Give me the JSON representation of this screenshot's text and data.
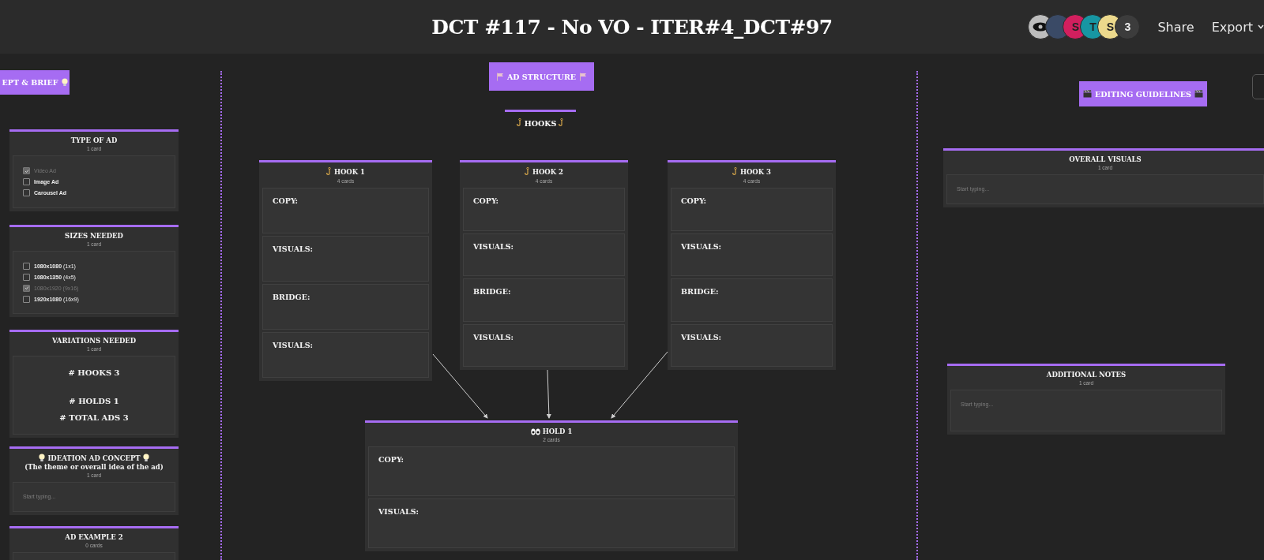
{
  "header": {
    "title": "DCT #117 - No VO - ITER#4_DCT#97",
    "avatars": [
      {
        "kind": "eye"
      },
      {
        "kind": "photo"
      },
      {
        "kind": "letter",
        "initial": "S",
        "color": "#d21f5e"
      },
      {
        "kind": "letter",
        "initial": "T",
        "color": "#1796a3"
      },
      {
        "kind": "letter",
        "initial": "S",
        "color": "#ecd98c"
      }
    ],
    "more_count": "3",
    "share": "Share",
    "export": "Export"
  },
  "banners": [
    {
      "kind": "brief",
      "text": "EPT & BRIEF"
    },
    {
      "kind": "structure",
      "text": "AD STRUCTURE"
    },
    {
      "kind": "editing",
      "text": "EDITING GUIDELINES"
    }
  ],
  "hooks_heading": {
    "text": "HOOKS"
  },
  "boards": [
    {
      "kind": "checklist",
      "title": "TYPE OF AD",
      "count": "1 card",
      "items": [
        {
          "label": "Video Ad",
          "checked": true
        },
        {
          "label": "Image Ad",
          "checked": false
        },
        {
          "label": "Carousel Ad",
          "checked": false
        }
      ]
    },
    {
      "kind": "checklist",
      "title": "SIZES NEEDED",
      "count": "1 card",
      "items": [
        {
          "label": "1080x1080",
          "detail": "(1x1)",
          "checked": false
        },
        {
          "label": "1080x1350",
          "detail": "(4x5)",
          "checked": false
        },
        {
          "label": "1080x1920",
          "detail": "(9x16)",
          "checked": true
        },
        {
          "label": "1920x1080",
          "detail": "(16x9)",
          "checked": false
        }
      ]
    },
    {
      "kind": "counts",
      "title": "VARIATIONS NEEDED",
      "count": "1 card",
      "lines": [
        "# HOOKS 3",
        "# HOLDS 1",
        "# TOTAL ADS 3"
      ]
    },
    {
      "kind": "ideation",
      "title": "IDEATION AD CONCEPT",
      "subtitle": "(The theme or overall idea of the ad)",
      "count": "1 card",
      "placeholder": "Start typing..."
    },
    {
      "kind": "empty",
      "title": "AD EXAMPLE 2",
      "count": "0 cards"
    },
    {
      "kind": "hook",
      "title": "HOOK 1",
      "count": "4 cards",
      "sections": [
        "COPY:",
        "VISUALS:",
        "BRIDGE:",
        "VISUALS:"
      ]
    },
    {
      "kind": "hook",
      "title": "HOOK 2",
      "count": "4 cards",
      "sections": [
        "COPY:",
        "VISUALS:",
        "BRIDGE:",
        "VISUALS:"
      ]
    },
    {
      "kind": "hook",
      "title": "HOOK 3",
      "count": "4 cards",
      "sections": [
        "COPY:",
        "VISUALS:",
        "BRIDGE:",
        "VISUALS:"
      ]
    },
    {
      "kind": "hold",
      "title": "HOLD 1",
      "count": "2 cards",
      "sections": [
        "COPY:",
        "VISUALS:"
      ]
    },
    {
      "kind": "note",
      "title": "OVERALL VISUALS",
      "count": "1 card",
      "placeholder": "Start typing..."
    },
    {
      "kind": "note",
      "title": "ADDITIONAL NOTES",
      "count": "1 card",
      "placeholder": "Start typing..."
    }
  ]
}
